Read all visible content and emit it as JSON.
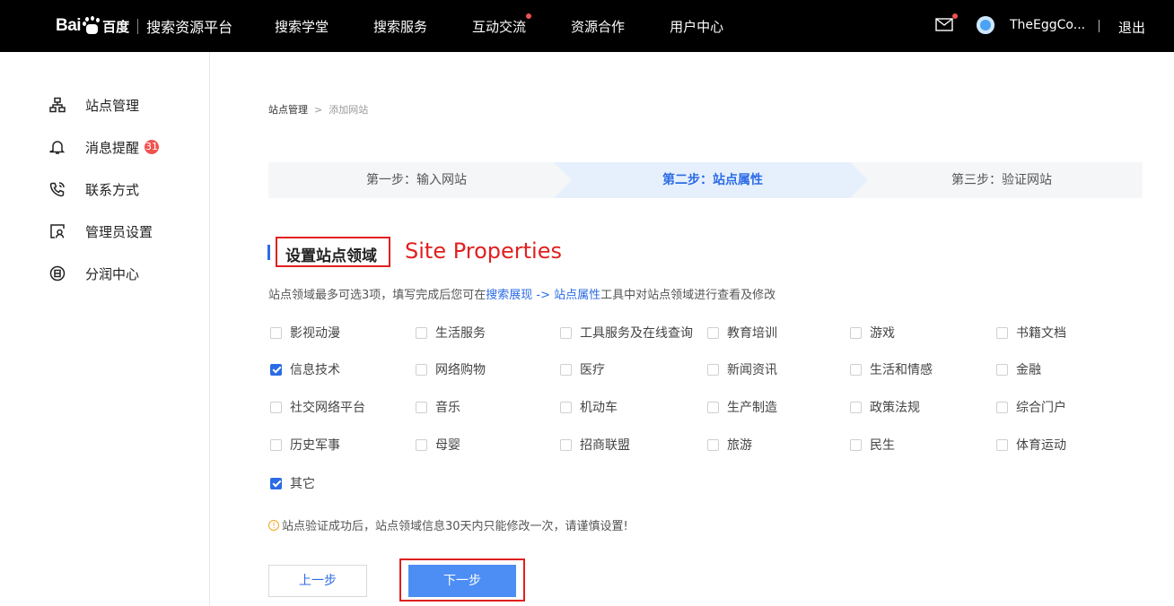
{
  "header": {
    "logo": {
      "bai": "Bai",
      "du_cn": "百度",
      "platform": "搜索资源平台"
    },
    "nav": [
      {
        "label": "搜索学堂",
        "dot": false
      },
      {
        "label": "搜索服务",
        "dot": false
      },
      {
        "label": "互动交流",
        "dot": true
      },
      {
        "label": "资源合作",
        "dot": false
      },
      {
        "label": "用户中心",
        "dot": false
      }
    ],
    "username": "TheEggCo...",
    "logout": "退出",
    "icons": {
      "mail": "mail-icon",
      "avatar": "avatar"
    }
  },
  "sidebar": {
    "items": [
      {
        "label": "站点管理",
        "icon": "sitemap-icon"
      },
      {
        "label": "消息提醒",
        "icon": "bell-icon",
        "badge": "31"
      },
      {
        "label": "联系方式",
        "icon": "phone-icon"
      },
      {
        "label": "管理员设置",
        "icon": "admin-icon"
      },
      {
        "label": "分润中心",
        "icon": "revenue-icon"
      }
    ]
  },
  "breadcrumb": {
    "root": "站点管理",
    "sep": ">",
    "current": "添加网站"
  },
  "steps": [
    {
      "label": "第一步：输入网站",
      "active": false
    },
    {
      "label": "第二步：站点属性",
      "active": true
    },
    {
      "label": "第三步：验证网站",
      "active": false
    }
  ],
  "section": {
    "title": "设置站点领域",
    "annotation": "Site Properties",
    "desc_prefix": "站点领域最多可选3项，填写完成后您可在",
    "desc_link": "搜索展现 -> 站点属性",
    "desc_suffix": "工具中对站点领域进行查看及修改"
  },
  "domains": [
    [
      {
        "label": "影视动漫",
        "checked": false
      },
      {
        "label": "生活服务",
        "checked": false
      },
      {
        "label": "工具服务及在线查询",
        "checked": false
      },
      {
        "label": "教育培训",
        "checked": false
      },
      {
        "label": "游戏",
        "checked": false
      },
      {
        "label": "书籍文档",
        "checked": false
      }
    ],
    [
      {
        "label": "信息技术",
        "checked": true
      },
      {
        "label": "网络购物",
        "checked": false
      },
      {
        "label": "医疗",
        "checked": false
      },
      {
        "label": "新闻资讯",
        "checked": false
      },
      {
        "label": "生活和情感",
        "checked": false
      },
      {
        "label": "金融",
        "checked": false
      }
    ],
    [
      {
        "label": "社交网络平台",
        "checked": false
      },
      {
        "label": "音乐",
        "checked": false
      },
      {
        "label": "机动车",
        "checked": false
      },
      {
        "label": "生产制造",
        "checked": false
      },
      {
        "label": "政策法规",
        "checked": false
      },
      {
        "label": "综合门户",
        "checked": false
      }
    ],
    [
      {
        "label": "历史军事",
        "checked": false
      },
      {
        "label": "母婴",
        "checked": false
      },
      {
        "label": "招商联盟",
        "checked": false
      },
      {
        "label": "旅游",
        "checked": false
      },
      {
        "label": "民生",
        "checked": false
      },
      {
        "label": "体育运动",
        "checked": false
      }
    ],
    [
      {
        "label": "其它",
        "checked": true
      }
    ]
  ],
  "warning": "站点验证成功后，站点领域信息30天内只能修改一次，请谨慎设置!",
  "buttons": {
    "prev": "上一步",
    "next": "下一步"
  },
  "colors": {
    "accent": "#2b6be5",
    "annotation_red": "#e02020",
    "badge_red": "#f0524f",
    "step_active_bg": "#e6f0fd",
    "step_bg": "#f5f6f8"
  }
}
